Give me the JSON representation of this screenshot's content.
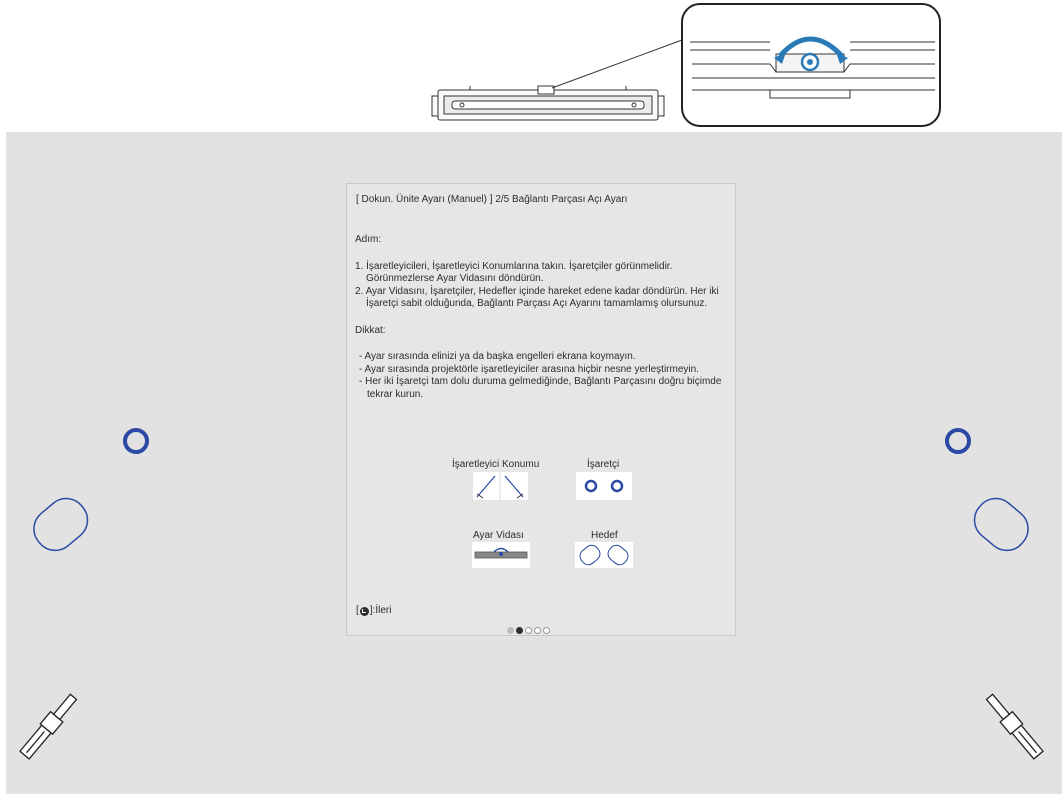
{
  "dialog": {
    "title": "[ Dokun. Ünite Ayarı (Manuel) ]  2/5 Bağlantı Parçası Açı Ayarı",
    "step_heading": "Adım:",
    "steps": [
      "1. İşaretleyicileri, İşaretleyici Konumlarına takın. İşaretçiler görünmelidir. Görünmezlerse Ayar Vidasını döndürün.",
      "2. Ayar Vidasını, İşaretçiler, Hedefler içinde hareket edene kadar döndürün. Her iki İşaretçi sabit olduğunda, Bağlantı Parçası Açı Ayarını tamamlamış olursunuz."
    ],
    "notice_heading": "Dikkat:",
    "notices": [
      "- Ayar sırasında elinizi ya da başka engelleri ekrana koymayın.",
      "- Ayar sırasında projektörle işaretleyiciler arasına hiçbir nesne yerleştirmeyin.",
      "- Her iki İşaretçi tam dolu duruma gelmediğinde, Bağlantı Parçasını doğru biçimde tekrar kurun."
    ],
    "labels": {
      "marker_position": "İşaretleyici Konumu",
      "pointer": "İşaretçi",
      "adjust_screw": "Ayar Vidası",
      "target": "Hedef"
    },
    "footer_next_label": "]:İleri",
    "footer_bracket": "[",
    "pager": {
      "total": 5,
      "current": 2
    }
  },
  "colors": {
    "accent_blue": "#2c4aa5",
    "screen_bg": "#e2e2e2",
    "dialog_bg": "#e6e6e6",
    "text": "#2d2d2d",
    "screw_highlight": "#2a7ab8"
  },
  "icons": [
    "enter-button-icon",
    "rotate-arrow-icon",
    "pointer-circle-icon",
    "target-icon",
    "marker-icon"
  ]
}
